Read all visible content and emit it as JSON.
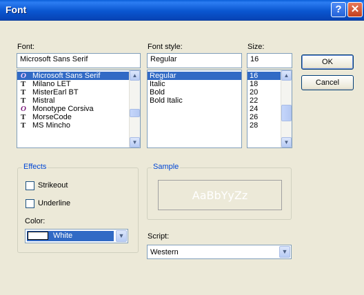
{
  "window": {
    "title": "Font",
    "help_glyph": "?",
    "close_glyph": "✕"
  },
  "font": {
    "label": "Font:",
    "value": "Microsoft Sans Serif",
    "items": [
      {
        "name": "Microsoft Sans Serif",
        "icon": "O",
        "icon_type": "opentype-icon",
        "selected": true
      },
      {
        "name": "Milano LET",
        "icon": "T",
        "icon_type": "truetype-icon"
      },
      {
        "name": "MisterEarl BT",
        "icon": "T",
        "icon_type": "truetype-icon"
      },
      {
        "name": "Mistral",
        "icon": "T",
        "icon_type": "truetype-icon"
      },
      {
        "name": "Monotype Corsiva",
        "icon": "O",
        "icon_type": "opentype-icon"
      },
      {
        "name": "MorseCode",
        "icon": "T",
        "icon_type": "truetype-icon"
      },
      {
        "name": "MS Mincho",
        "icon": "T",
        "icon_type": "truetype-icon"
      }
    ]
  },
  "style": {
    "label": "Font style:",
    "value": "Regular",
    "items": [
      "Regular",
      "Italic",
      "Bold",
      "Bold Italic"
    ]
  },
  "size": {
    "label": "Size:",
    "value": "16",
    "items": [
      "16",
      "18",
      "20",
      "22",
      "24",
      "26",
      "28"
    ]
  },
  "buttons": {
    "ok": "OK",
    "cancel": "Cancel"
  },
  "effects": {
    "title": "Effects",
    "strikeout": "Strikeout",
    "underline": "Underline",
    "color_label": "Color:",
    "color_value": "White"
  },
  "sample": {
    "title": "Sample",
    "text": "AaBbYyZz"
  },
  "script": {
    "label": "Script:",
    "value": "Western"
  },
  "colors": {
    "title_bar": "#0a56d0",
    "selection": "#316ac5",
    "group_title": "#0046d5"
  }
}
